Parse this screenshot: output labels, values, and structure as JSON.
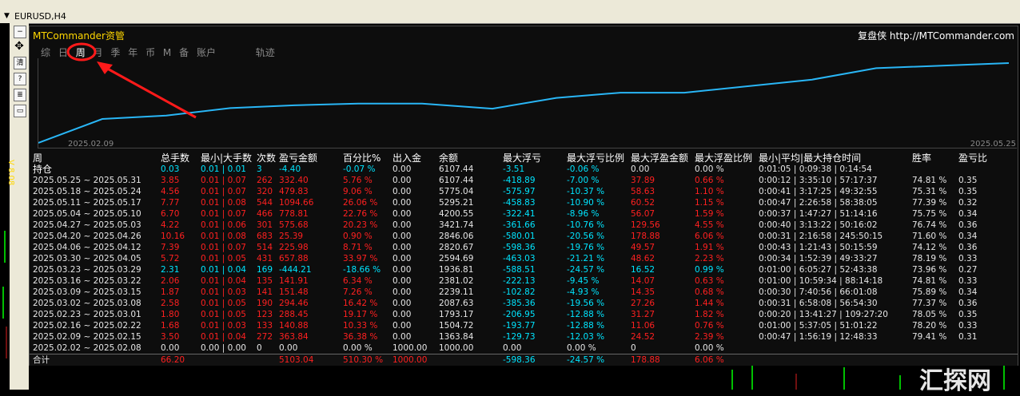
{
  "window": {
    "symbol": "EURUSD,H4"
  },
  "panel": {
    "brand": "MTCommander资管",
    "site_label": "复盘侠",
    "site_url": "http://MTCommander.com",
    "tabs": [
      "综",
      "日",
      "周",
      "月",
      "季",
      "年",
      "币",
      "M",
      "备",
      "账户",
      "轨迹"
    ],
    "active_tab": "周"
  },
  "chart_data": {
    "type": "line",
    "x": [
      "2025.02.09",
      "2025.05.25"
    ],
    "values": [
      0,
      210,
      240,
      305,
      330,
      345,
      345,
      300,
      395,
      440,
      440,
      555,
      655,
      700
    ],
    "start_label": "2025.02.09",
    "end_label": "2025.05.25",
    "color": "#29b6f6"
  },
  "side_scale": "V 8.08",
  "table": {
    "header1": "周",
    "header2": "持仓",
    "columns": [
      "总手数",
      "最小|大手数",
      "次数",
      "盈亏金额",
      "百分比%",
      "出入金",
      "余额",
      "最大浮亏",
      "最大浮亏比例",
      "最大浮盈金额",
      "最大浮盈比例",
      "最小|平均|最大持仓时间",
      "胜率",
      "盈亏比"
    ],
    "holding": [
      "",
      "0.03",
      "0.01 | 0.01",
      "3",
      "-4.40",
      "-0.07 %",
      "0.00",
      "6107.44",
      "-3.51",
      "-0.06 %",
      "0.00",
      "0.00 %",
      "0:01:05 | 0:09:38 | 0:14:54",
      "",
      ""
    ],
    "rows": [
      [
        "2025.05.25 ~ 2025.05.31",
        "3.85",
        "0.01 | 0.07",
        "262",
        "332.40",
        "5.76 %",
        "0.00",
        "6107.44",
        "-418.89",
        "-7.00 %",
        "37.89",
        "0.66 %",
        "0:00:12 | 3:35:10 | 57:17:37",
        "74.81 %",
        "0.35"
      ],
      [
        "2025.05.18 ~ 2025.05.24",
        "4.56",
        "0.01 | 0.07",
        "320",
        "479.83",
        "9.06 %",
        "0.00",
        "5775.04",
        "-575.97",
        "-10.37 %",
        "58.63",
        "1.10 %",
        "0:00:41 | 3:17:25 | 49:32:55",
        "75.31 %",
        "0.35"
      ],
      [
        "2025.05.11 ~ 2025.05.17",
        "7.77",
        "0.01 | 0.08",
        "544",
        "1094.66",
        "26.06 %",
        "0.00",
        "5295.21",
        "-458.83",
        "-10.90 %",
        "60.52",
        "1.15 %",
        "0:00:47 | 2:26:58 | 58:38:05",
        "77.39 %",
        "0.32"
      ],
      [
        "2025.05.04 ~ 2025.05.10",
        "6.70",
        "0.01 | 0.07",
        "466",
        "778.81",
        "22.76 %",
        "0.00",
        "4200.55",
        "-322.41",
        "-8.96 %",
        "56.07",
        "1.59 %",
        "0:00:37 | 1:47:27 | 51:14:16",
        "75.75 %",
        "0.34"
      ],
      [
        "2025.04.27 ~ 2025.05.03",
        "4.22",
        "0.01 | 0.06",
        "301",
        "575.68",
        "20.23 %",
        "0.00",
        "3421.74",
        "-361.66",
        "-10.76 %",
        "129.56",
        "4.55 %",
        "0:00:40 | 3:13:22 | 50:16:02",
        "76.74 %",
        "0.36"
      ],
      [
        "2025.04.20 ~ 2025.04.26",
        "10.16",
        "0.01 | 0.08",
        "683",
        "25.39",
        "0.90 %",
        "0.00",
        "2846.06",
        "-580.01",
        "-20.56 %",
        "178.88",
        "6.06 %",
        "0:00:31 | 2:16:58 | 245:50:15",
        "71.60 %",
        "0.34"
      ],
      [
        "2025.04.06 ~ 2025.04.12",
        "7.39",
        "0.01 | 0.07",
        "514",
        "225.98",
        "8.71 %",
        "0.00",
        "2820.67",
        "-598.36",
        "-19.76 %",
        "49.57",
        "1.91 %",
        "0:00:43 | 1:21:43 | 50:15:59",
        "74.12 %",
        "0.36"
      ],
      [
        "2025.03.30 ~ 2025.04.05",
        "5.72",
        "0.01 | 0.05",
        "431",
        "657.88",
        "33.97 %",
        "0.00",
        "2594.69",
        "-463.03",
        "-21.21 %",
        "48.62",
        "2.23 %",
        "0:00:34 | 1:52:39 | 49:33:27",
        "78.19 %",
        "0.33"
      ],
      [
        "2025.03.23 ~ 2025.03.29",
        "2.31",
        "0.01 | 0.04",
        "169",
        "-444.21",
        "-18.66 %",
        "0.00",
        "1936.81",
        "-588.51",
        "-24.57 %",
        "16.52",
        "0.99 %",
        "0:01:00 | 6:05:27 | 52:43:38",
        "73.96 %",
        "0.27"
      ],
      [
        "2025.03.16 ~ 2025.03.22",
        "2.06",
        "0.01 | 0.04",
        "135",
        "141.91",
        "6.34 %",
        "0.00",
        "2381.02",
        "-222.13",
        "-9.45 %",
        "14.07",
        "0.63 %",
        "0:01:00 | 10:59:34 | 88:14:18",
        "74.81 %",
        "0.33"
      ],
      [
        "2025.03.09 ~ 2025.03.15",
        "1.87",
        "0.01 | 0.03",
        "141",
        "151.48",
        "7.26 %",
        "0.00",
        "2239.11",
        "-102.82",
        "-4.93 %",
        "14.35",
        "0.68 %",
        "0:00:30 | 7:40:56 | 66:01:08",
        "75.89 %",
        "0.34"
      ],
      [
        "2025.03.02 ~ 2025.03.08",
        "2.58",
        "0.01 | 0.05",
        "190",
        "294.46",
        "16.42 %",
        "0.00",
        "2087.63",
        "-385.36",
        "-19.56 %",
        "27.26",
        "1.44 %",
        "0:00:31 | 6:58:08 | 56:54:30",
        "77.37 %",
        "0.36"
      ],
      [
        "2025.02.23 ~ 2025.03.01",
        "1.80",
        "0.01 | 0.05",
        "123",
        "288.45",
        "19.17 %",
        "0.00",
        "1793.17",
        "-206.95",
        "-12.88 %",
        "31.27",
        "1.82 %",
        "0:00:20 | 13:41:27 | 109:27:20",
        "78.05 %",
        "0.35"
      ],
      [
        "2025.02.16 ~ 2025.02.22",
        "1.68",
        "0.01 | 0.03",
        "133",
        "140.88",
        "10.33 %",
        "0.00",
        "1504.72",
        "-193.77",
        "-12.88 %",
        "11.06",
        "0.76 %",
        "0:01:00 | 5:37:05 | 51:01:22",
        "78.20 %",
        "0.33"
      ],
      [
        "2025.02.09 ~ 2025.02.15",
        "3.50",
        "0.01 | 0.04",
        "272",
        "363.84",
        "36.38 %",
        "0.00",
        "1363.84",
        "-129.73",
        "-12.03 %",
        "24.52",
        "2.39 %",
        "0:00:47 | 1:56:19 | 12:48:33",
        "79.41 %",
        "0.31"
      ],
      [
        "2025.02.02 ~ 2025.02.08",
        "0.00",
        "0.00 | 0.00",
        "0",
        "0.00",
        "0.00 %",
        "1000.00",
        "1000.00",
        "0.00",
        "0.00 %",
        "0",
        "0.00 %",
        "",
        "",
        ""
      ]
    ],
    "row_colors": [
      "red",
      "red",
      "red",
      "red",
      "red",
      "red",
      "red",
      "red",
      "cyan",
      "red",
      "red",
      "red",
      "red",
      "red",
      "red",
      "white"
    ],
    "total": [
      "合计",
      "66.20",
      "",
      "",
      "5103.04",
      "510.30 %",
      "1000.00",
      "",
      "-598.36",
      "-24.57 %",
      "178.88",
      "6.06 %",
      "",
      "",
      ""
    ]
  },
  "watermark": "汇探网"
}
